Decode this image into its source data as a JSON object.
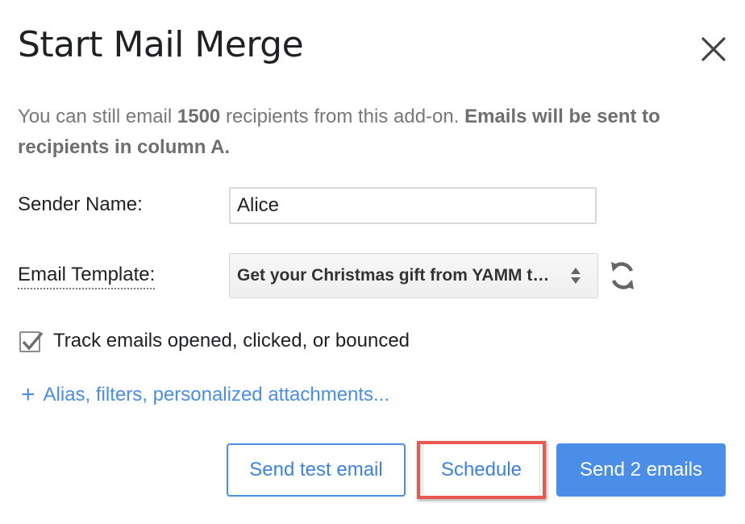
{
  "dialog": {
    "title": "Start Mail Merge",
    "close_icon": "close-icon"
  },
  "intro": {
    "part1": "You can still email ",
    "count": "1500",
    "part2": " recipients from this add-on. ",
    "bold_tail": "Emails will be sent to recipients in column A."
  },
  "form": {
    "sender_label": "Sender Name:",
    "sender_value": "Alice",
    "template_label": "Email Template:",
    "template_value": "Get your Christmas gift from YAMM t…",
    "refresh_icon": "refresh-icon"
  },
  "tracking": {
    "checked": true,
    "label": "Track emails opened, clicked, or bounced"
  },
  "advanced": {
    "plus": "+",
    "label": "Alias, filters, personalized attachments..."
  },
  "buttons": {
    "test": "Send test email",
    "schedule": "Schedule",
    "send": "Send 2 emails"
  },
  "colors": {
    "accent": "#4a8ee8",
    "highlight": "#e8584f",
    "muted_text": "#777777"
  }
}
